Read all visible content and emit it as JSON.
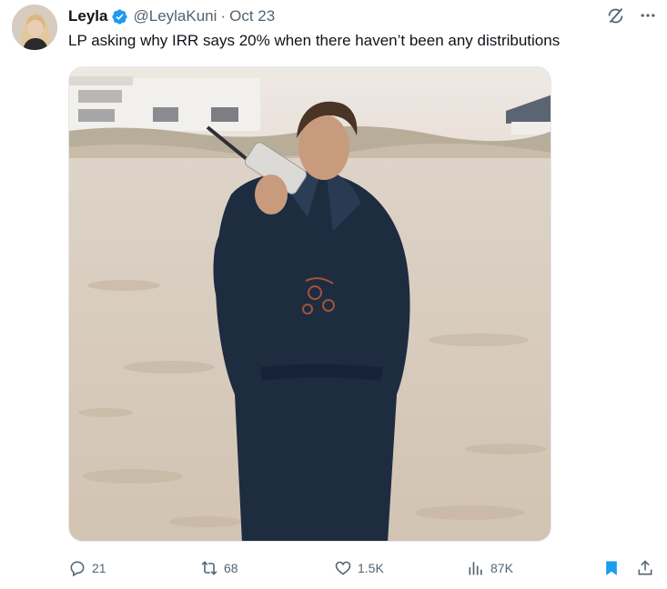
{
  "tweet": {
    "author_name": "Leyla",
    "handle": "@LeylaKuni",
    "separator": "·",
    "date": "Oct 23",
    "text": "LP asking why IRR says 20% when there haven’t been any distributions"
  },
  "icons": {
    "verified": "verified-badge-icon",
    "grok": "grok-icon",
    "more": "more-icon",
    "reply": "reply-icon",
    "retweet": "retweet-icon",
    "like": "heart-icon",
    "views": "views-icon",
    "bookmark": "bookmark-icon",
    "share": "share-icon"
  },
  "actions": {
    "replies": "21",
    "retweets": "68",
    "likes": "1.5K",
    "views": "87K"
  },
  "colors": {
    "accent": "#1d9bf0",
    "text_primary": "#0f1419",
    "text_secondary": "#536471"
  }
}
